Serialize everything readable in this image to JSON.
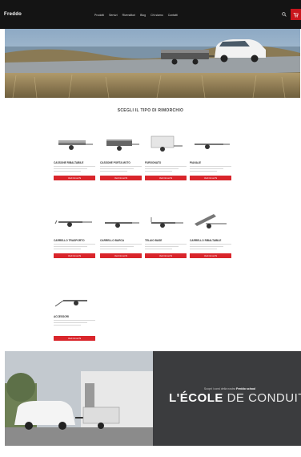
{
  "header": {
    "logo": "Freddo",
    "nav": [
      "Prodotti",
      "Servizi",
      "Rivenditori",
      "Blog",
      "Chi siamo",
      "Contatti"
    ],
    "right": ""
  },
  "catalog": {
    "title": "SCEGLI IL TIPO DI RIMORCHIO",
    "button": "Vedi rimorchi",
    "products": [
      {
        "name": "Cassone ribaltabile"
      },
      {
        "name": "Cassone porta moto"
      },
      {
        "name": "Furgonato"
      },
      {
        "name": "Pianale"
      },
      {
        "name": "Carrello trasporto"
      },
      {
        "name": "Carrello barca"
      },
      {
        "name": "Telaio base"
      },
      {
        "name": "Carrello ribaltabile"
      },
      {
        "name": "Accessori"
      }
    ]
  },
  "promo": {
    "sub_pre": "Scopri i corsi della nostra",
    "sub_bold": "Freddo school",
    "title_bold": "L'ÉCOLE",
    "title_light": "DE CONDUITE"
  },
  "footer": {
    "left": "",
    "right": ""
  }
}
